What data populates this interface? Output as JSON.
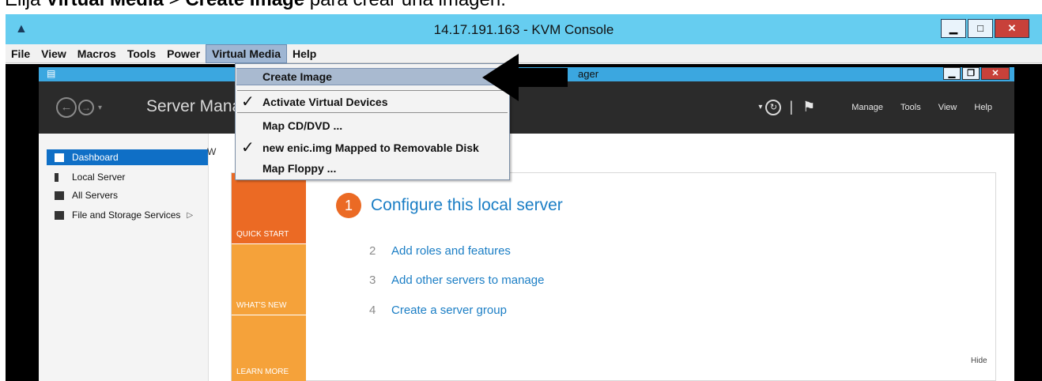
{
  "caption": {
    "pre": "Elija ",
    "strong1": "Virtual Media",
    "mid": " > ",
    "strong2": "Create Image",
    "post": " para crear una imagen."
  },
  "kvm": {
    "title": "14.17.191.163 - KVM Console",
    "menu": [
      "File",
      "View",
      "Macros",
      "Tools",
      "Power",
      "Virtual Media",
      "Help"
    ],
    "active_menu": "Virtual Media"
  },
  "virtual_media_menu": {
    "items": [
      {
        "label": "Create Image",
        "checked": false,
        "highlighted": true
      },
      {
        "label": "Activate Virtual Devices",
        "checked": true
      },
      {
        "label": "Map CD/DVD ...",
        "checked": false
      },
      {
        "label": "new enic.img Mapped to Removable Disk",
        "checked": true
      },
      {
        "label": "Map Floppy ...",
        "checked": false
      }
    ],
    "check_glyph": "✓"
  },
  "server_manager": {
    "title_fragment": "ager",
    "header_title": "Server Mana",
    "header_menu": [
      "Manage",
      "Tools",
      "View",
      "Help"
    ],
    "sidebar": [
      {
        "label": "Dashboard",
        "active": true
      },
      {
        "label": "Local Server"
      },
      {
        "label": "All Servers"
      },
      {
        "label": "File and Storage Services",
        "arrow": "▷"
      }
    ],
    "welcome_fragment": "W",
    "tiles": [
      "QUICK START",
      "WHAT'S NEW",
      "LEARN MORE"
    ],
    "step1": {
      "num": "1",
      "text": "Configure this local server"
    },
    "steps": [
      {
        "num": "2",
        "text": "Add roles and features"
      },
      {
        "num": "3",
        "text": "Add other servers to manage"
      },
      {
        "num": "4",
        "text": "Create a server group"
      }
    ],
    "hide_label": "Hide"
  },
  "colors": {
    "kvm_titlebar": "#66cdf0",
    "sm_titlebar": "#3ba7e0",
    "sm_header": "#2b2b2b",
    "quick_start": "#eb6a24",
    "tile_orange": "#f5a23a",
    "link_blue": "#1b7ec5",
    "sidebar_active": "#0f6fc6",
    "menu_highlight": "#a9bad0"
  }
}
